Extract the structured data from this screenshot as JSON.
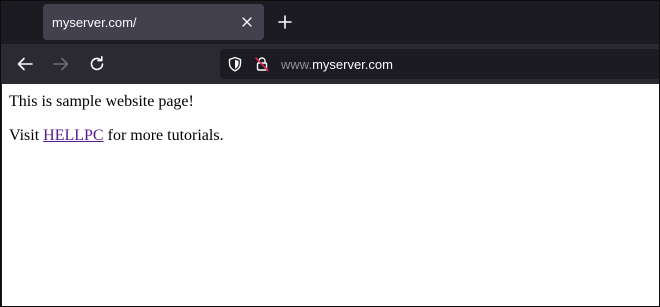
{
  "browser": {
    "tab": {
      "title": "myserver.com/"
    },
    "address_bar": {
      "prefix": "www.",
      "domain": "myserver.com"
    }
  },
  "page": {
    "paragraph1": "This is sample website page!",
    "paragraph2": {
      "before": "Visit ",
      "link": "HELLPC",
      "after": " for more tutorials."
    }
  },
  "colors": {
    "chrome_dark": "#1c1b22",
    "tab_active": "#42414d",
    "toolbar": "#2b2a33",
    "link_visited": "#551a8b"
  }
}
